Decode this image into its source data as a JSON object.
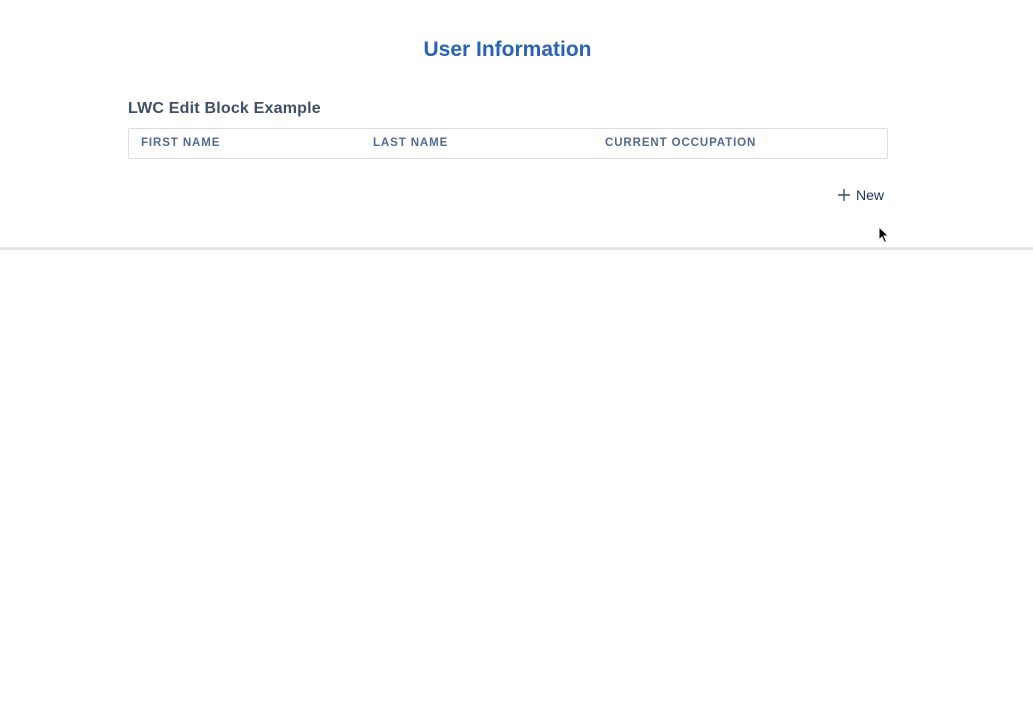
{
  "header": {
    "title": "User Information"
  },
  "block": {
    "title": "LWC Edit Block Example",
    "columns": [
      "FIRST NAME",
      "LAST NAME",
      "CURRENT OCCUPATION"
    ]
  },
  "actions": {
    "new_label": "New",
    "new_icon": "plus-icon"
  },
  "colors": {
    "title": "#2a62b5",
    "header_text": "#54698d",
    "border": "#d8dde6",
    "button_text": "#16325c"
  }
}
